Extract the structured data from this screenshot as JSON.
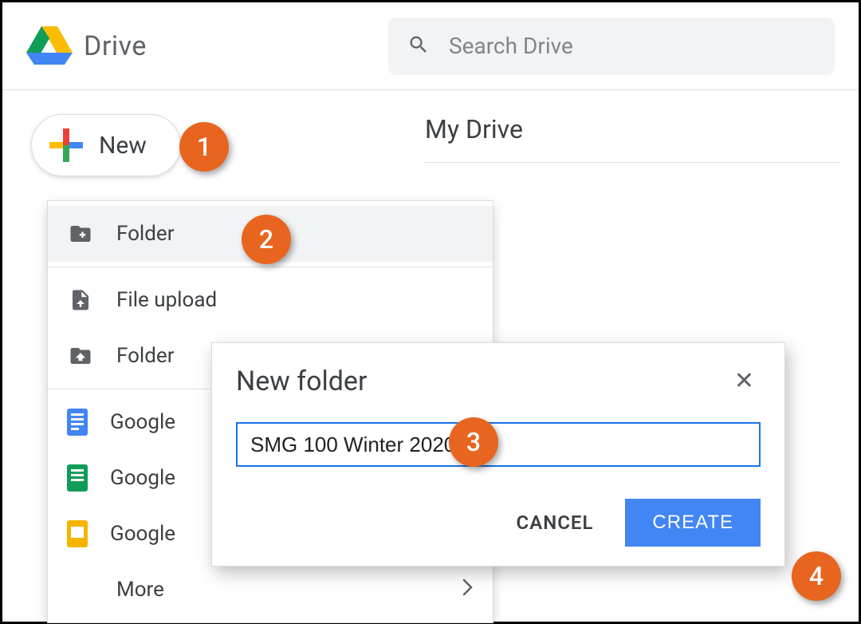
{
  "header": {
    "product_name": "Drive",
    "search_placeholder": "Search Drive"
  },
  "sidebar": {
    "new_button_label": "New"
  },
  "page": {
    "title": "My Drive"
  },
  "new_menu": {
    "items": [
      {
        "icon": "folder-new-icon",
        "label": "Folder",
        "type": "action",
        "highlighted": true
      },
      {
        "icon": "file-upload-icon",
        "label": "File upload",
        "type": "action"
      },
      {
        "icon": "folder-upload-icon",
        "label": "Folder",
        "type": "action"
      },
      {
        "icon": "docs-icon",
        "label": "Google",
        "type": "app"
      },
      {
        "icon": "sheets-icon",
        "label": "Google",
        "type": "app"
      },
      {
        "icon": "slides-icon",
        "label": "Google",
        "type": "app"
      },
      {
        "icon": "more-icon",
        "label": "More",
        "type": "submenu"
      }
    ]
  },
  "modal": {
    "title": "New folder",
    "input_value": "SMG 100 Winter 2020",
    "cancel_label": "CANCEL",
    "create_label": "CREATE"
  },
  "callouts": {
    "b1": "1",
    "b2": "2",
    "b3": "3",
    "b4": "4"
  }
}
